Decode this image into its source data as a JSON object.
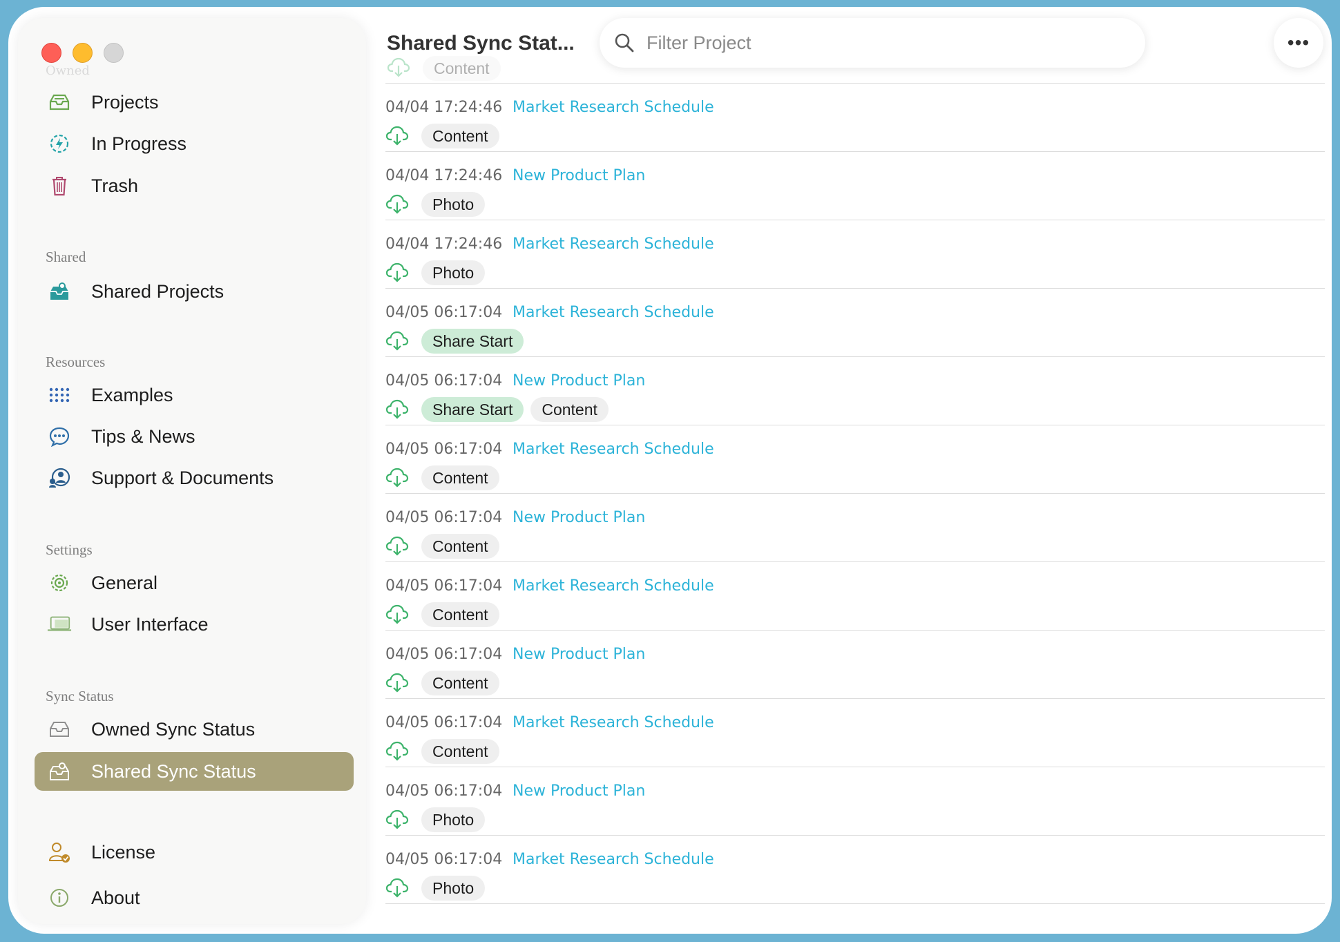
{
  "window": {
    "title": "Shared Sync Status"
  },
  "sidebar": {
    "ghost_group": "Owned",
    "owned_items": [
      {
        "label": "Projects",
        "icon": "tray-icon"
      },
      {
        "label": "In Progress",
        "icon": "progress-bolt-icon"
      },
      {
        "label": "Trash",
        "icon": "trash-icon"
      }
    ],
    "shared": {
      "header": "Shared",
      "items": [
        {
          "label": "Shared Projects",
          "icon": "shared-tray-icon"
        }
      ]
    },
    "resources": {
      "header": "Resources",
      "items": [
        {
          "label": "Examples",
          "icon": "grid-dots-icon"
        },
        {
          "label": "Tips & News",
          "icon": "chat-bubble-icon"
        },
        {
          "label": "Support & Documents",
          "icon": "support-people-icon"
        }
      ]
    },
    "settings": {
      "header": "Settings",
      "items": [
        {
          "label": "General",
          "icon": "gear-icon"
        },
        {
          "label": "User Interface",
          "icon": "display-icon"
        }
      ]
    },
    "sync_status": {
      "header": "Sync Status",
      "items": [
        {
          "label": "Owned Sync Status",
          "icon": "tray-outline-icon"
        },
        {
          "label": "Shared Sync Status",
          "icon": "shared-tray-outline-icon",
          "active": true
        }
      ]
    },
    "footer_items": [
      {
        "label": "License",
        "icon": "license-user-icon"
      },
      {
        "label": "About",
        "icon": "info-icon"
      }
    ]
  },
  "header": {
    "title": "Shared Sync Stat...",
    "search_placeholder": "Filter Project",
    "more_label": "•••"
  },
  "ghost_row_tag": "Content",
  "rows": [
    {
      "time": "04/04 17:24:46",
      "project": "Market Research Schedule",
      "tags": [
        "Content"
      ]
    },
    {
      "time": "04/04 17:24:46",
      "project": "New Product Plan",
      "tags": [
        "Photo"
      ]
    },
    {
      "time": "04/04 17:24:46",
      "project": "Market Research Schedule",
      "tags": [
        "Photo"
      ]
    },
    {
      "time": "04/05 06:17:04",
      "project": "Market Research Schedule",
      "tags": [
        "Share Start"
      ]
    },
    {
      "time": "04/05 06:17:04",
      "project": "New Product Plan",
      "tags": [
        "Share Start",
        "Content"
      ]
    },
    {
      "time": "04/05 06:17:04",
      "project": "Market Research Schedule",
      "tags": [
        "Content"
      ]
    },
    {
      "time": "04/05 06:17:04",
      "project": "New Product Plan",
      "tags": [
        "Content"
      ]
    },
    {
      "time": "04/05 06:17:04",
      "project": "Market Research Schedule",
      "tags": [
        "Content"
      ]
    },
    {
      "time": "04/05 06:17:04",
      "project": "New Product Plan",
      "tags": [
        "Content"
      ]
    },
    {
      "time": "04/05 06:17:04",
      "project": "Market Research Schedule",
      "tags": [
        "Content"
      ]
    },
    {
      "time": "04/05 06:17:04",
      "project": "New Product Plan",
      "tags": [
        "Photo"
      ]
    },
    {
      "time": "04/05 06:17:04",
      "project": "Market Research Schedule",
      "tags": [
        "Photo"
      ]
    }
  ],
  "colors": {
    "accent_link": "#2cb3d8",
    "active_sidebar": "#a9a27a",
    "share_tag": "#cdecd7",
    "cloud_green": "#3db36b"
  }
}
